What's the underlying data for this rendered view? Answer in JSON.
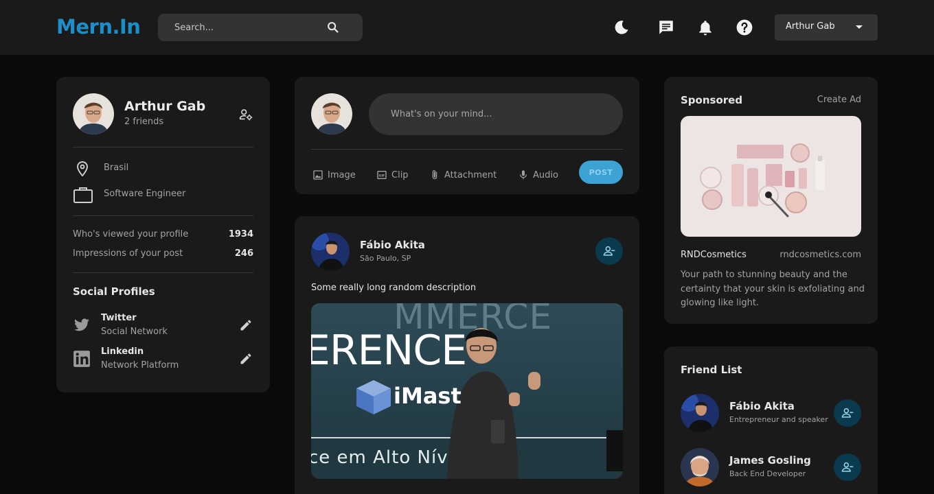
{
  "brand": {
    "logo": "Mern.In",
    "accent": "#1b8fc9"
  },
  "search": {
    "placeholder": "Search..."
  },
  "nav": {
    "icons": [
      "dark-mode-icon",
      "message-icon",
      "notification-icon",
      "help-icon"
    ],
    "user": "Arthur Gab"
  },
  "profile": {
    "name": "Arthur Gab",
    "friends": "2 friends",
    "location": "Brasil",
    "occupation": "Software Engineer",
    "stats": [
      {
        "label": "Who's viewed your profile",
        "value": "1934"
      },
      {
        "label": "Impressions of your post",
        "value": "246"
      }
    ],
    "social_title": "Social Profiles",
    "socials": [
      {
        "name": "Twitter",
        "type": "Social Network"
      },
      {
        "name": "Linkedin",
        "type": "Network Platform"
      }
    ]
  },
  "composer": {
    "placeholder": "What's on your mind...",
    "actions": [
      "Image",
      "Clip",
      "Attachment",
      "Audio"
    ],
    "post": "POST"
  },
  "post": {
    "author": "Fábio Akita",
    "location": "São Paulo, SP",
    "description": "Some really long random description",
    "image_text": {
      "line1": "MMERCE",
      "line2": "ERENCE",
      "brand": "iMast",
      "line3": "ce em Alto Nív"
    }
  },
  "sponsored": {
    "title": "Sponsored",
    "create_ad": "Create Ad",
    "brand": "RNDCosmetics",
    "site": "rndcosmetics.com",
    "text": "Your path to stunning beauty and the certainty that your skin is exfoliating and glowing like light."
  },
  "friends": {
    "title": "Friend List",
    "items": [
      {
        "name": "Fábio Akita",
        "role": "Entrepreneur and speaker"
      },
      {
        "name": "James Gosling",
        "role": "Back End Developer"
      }
    ]
  }
}
